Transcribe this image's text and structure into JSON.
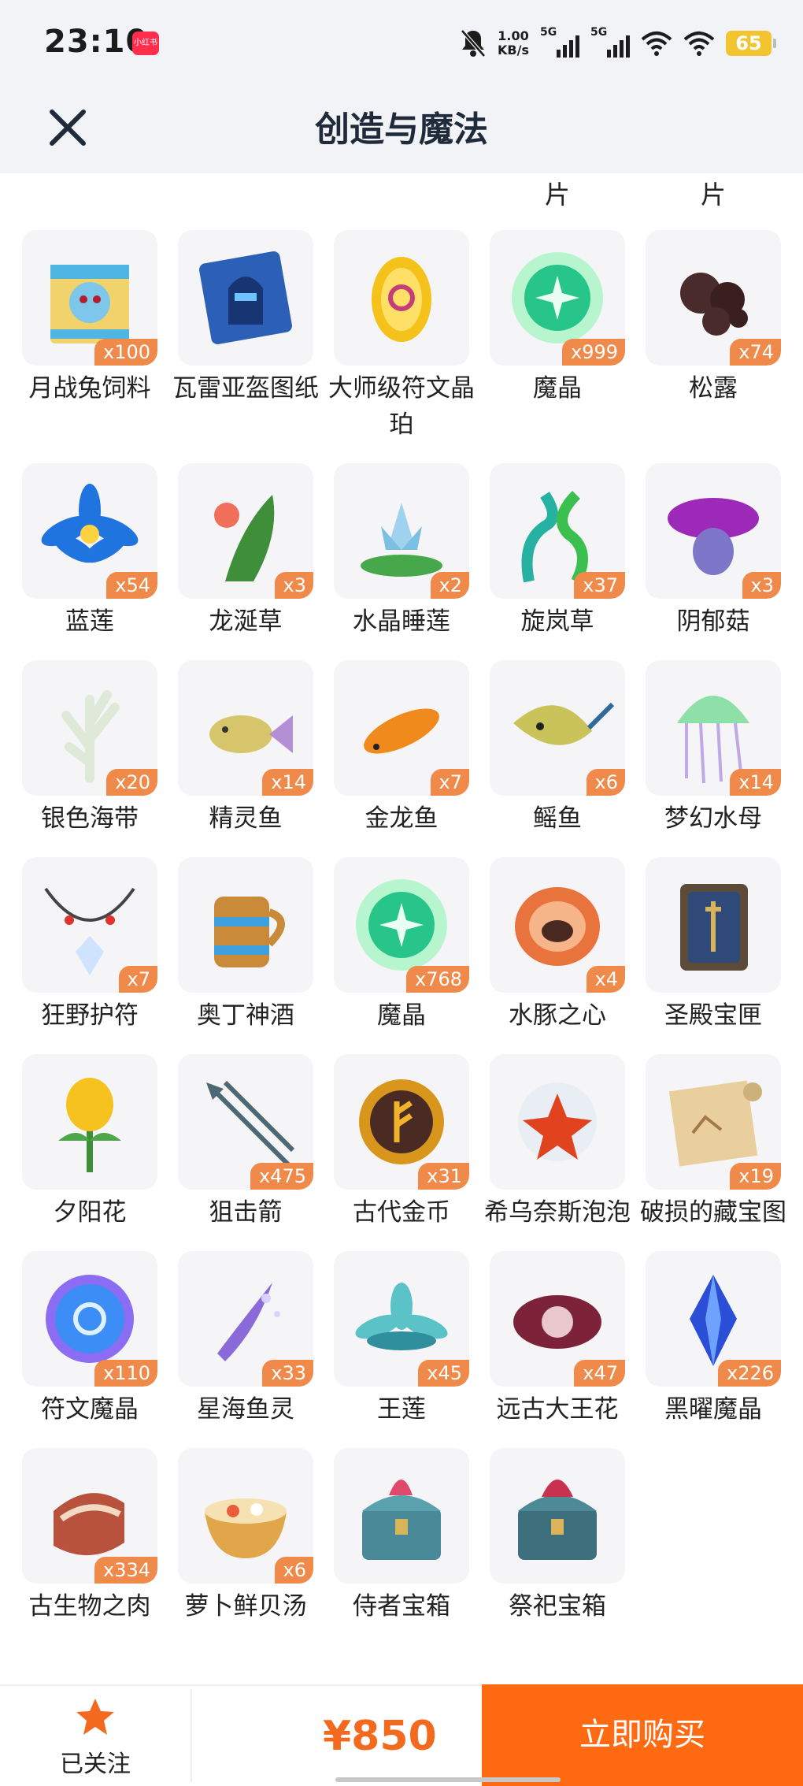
{
  "status_bar": {
    "time": "23:10",
    "app_badge": "小红书",
    "net_speed_value": "1.00",
    "net_speed_unit": "KB/s",
    "sim1": "5G",
    "sim2": "5G",
    "battery": "65"
  },
  "header": {
    "title": "创造与魔法"
  },
  "partial_labels": [
    "片",
    "片"
  ],
  "items": [
    {
      "name": "月战兔饲料",
      "qty": "x100",
      "icon": "rabbit-feed-bag-icon"
    },
    {
      "name": "瓦雷亚盔图纸",
      "qty": "",
      "icon": "helmet-blueprint-icon"
    },
    {
      "name": "大师级符文晶珀",
      "qty": "",
      "icon": "rune-amber-icon"
    },
    {
      "name": "魔晶",
      "qty": "x999",
      "icon": "magic-crystal-icon"
    },
    {
      "name": "松露",
      "qty": "x74",
      "icon": "truffle-icon"
    },
    {
      "name": "蓝莲",
      "qty": "x54",
      "icon": "blue-lotus-icon"
    },
    {
      "name": "龙涎草",
      "qty": "x3",
      "icon": "dragon-herb-icon"
    },
    {
      "name": "水晶睡莲",
      "qty": "x2",
      "icon": "crystal-water-lily-icon"
    },
    {
      "name": "旋岚草",
      "qty": "x37",
      "icon": "whirl-grass-icon"
    },
    {
      "name": "阴郁菇",
      "qty": "x3",
      "icon": "gloomy-mushroom-icon"
    },
    {
      "name": "银色海带",
      "qty": "x20",
      "icon": "silver-kelp-icon"
    },
    {
      "name": "精灵鱼",
      "qty": "x14",
      "icon": "spirit-fish-icon"
    },
    {
      "name": "金龙鱼",
      "qty": "x7",
      "icon": "golden-arowana-icon"
    },
    {
      "name": "鳐鱼",
      "qty": "x6",
      "icon": "stingray-icon"
    },
    {
      "name": "梦幻水母",
      "qty": "x14",
      "icon": "dream-jellyfish-icon"
    },
    {
      "name": "狂野护符",
      "qty": "x7",
      "icon": "wild-amulet-icon"
    },
    {
      "name": "奥丁神酒",
      "qty": "",
      "icon": "odin-mead-icon"
    },
    {
      "name": "魔晶",
      "qty": "x768",
      "icon": "magic-crystal-icon"
    },
    {
      "name": "水豚之心",
      "qty": "x4",
      "icon": "capybara-heart-icon"
    },
    {
      "name": "圣殿宝匣",
      "qty": "",
      "icon": "temple-casket-icon"
    },
    {
      "name": "夕阳花",
      "qty": "",
      "icon": "sunset-flower-icon"
    },
    {
      "name": "狙击箭",
      "qty": "x475",
      "icon": "sniper-arrow-icon"
    },
    {
      "name": "古代金币",
      "qty": "x31",
      "icon": "ancient-gold-coin-icon"
    },
    {
      "name": "希乌奈斯泡泡",
      "qty": "",
      "icon": "red-bubble-flower-icon"
    },
    {
      "name": "破损的藏宝图",
      "qty": "x19",
      "icon": "treasure-map-icon"
    },
    {
      "name": "符文魔晶",
      "qty": "x110",
      "icon": "rune-magic-orb-icon"
    },
    {
      "name": "星海鱼灵",
      "qty": "x33",
      "icon": "star-sea-fish-spirit-icon"
    },
    {
      "name": "王莲",
      "qty": "x45",
      "icon": "king-lotus-icon"
    },
    {
      "name": "远古大王花",
      "qty": "x47",
      "icon": "ancient-rafflesia-icon"
    },
    {
      "name": "黑曜魔晶",
      "qty": "x226",
      "icon": "obsidian-crystal-icon"
    },
    {
      "name": "古生物之肉",
      "qty": "x334",
      "icon": "ancient-meat-icon"
    },
    {
      "name": "萝卜鲜贝汤",
      "qty": "x6",
      "icon": "radish-scallop-soup-icon"
    },
    {
      "name": "侍者宝箱",
      "qty": "",
      "icon": "attendant-chest-icon"
    },
    {
      "name": "祭祀宝箱",
      "qty": "",
      "icon": "ritual-chest-icon"
    }
  ],
  "bottom_bar": {
    "follow_label": "已关注",
    "price": "¥850",
    "buy_label": "立即购买"
  },
  "colors": {
    "accent": "#ff6a12",
    "price": "#f36a1f",
    "qty_badge": "#ef8a4a",
    "header_bg": "#f1f3f6"
  }
}
